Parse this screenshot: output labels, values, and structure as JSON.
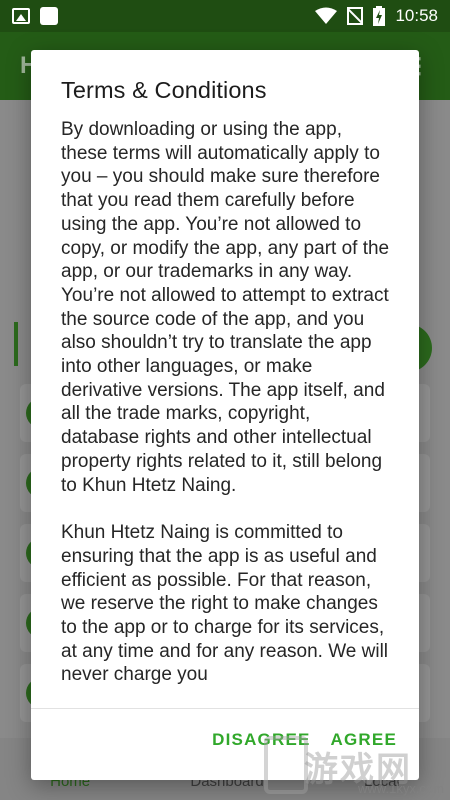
{
  "status_bar": {
    "time": "10:58",
    "icons": [
      "image-icon",
      "app-icon",
      "wifi-icon",
      "no-sim-icon",
      "battery-charging-icon"
    ]
  },
  "dialog": {
    "title": "Terms & Conditions",
    "paragraphs": [
      "By downloading or using the app, these terms will automatically apply to you – you should make sure therefore that you read them carefully before using the app. You’re not allowed to copy, or modify the app, any part of the app, or our trademarks in any way. You’re not allowed to attempt to extract the source code of the app, and you also shouldn’t try to translate the app into other languages, or make derivative versions. The app itself, and all the trade marks, copyright, database rights and other intellectual property rights related to it, still belong to Khun Htetz Naing.",
      "Khun Htetz Naing is committed to ensuring that the app is as useful and efficient as possible. For that reason, we reserve the right to make changes to the app or to charge for its services, at any time and for any reason. We will never charge you"
    ],
    "disagree_label": "DISAGREE",
    "agree_label": "AGREE"
  },
  "background_app": {
    "title_partial": "H",
    "bottom_nav": [
      "Home",
      "Dashboard",
      "Local"
    ]
  },
  "watermark": {
    "text": "游戏网",
    "url": "www.1kyx.com"
  },
  "colors": {
    "accent": "#31a82b",
    "status_bar": "#1f4d12",
    "app_bar": "#245c16"
  }
}
